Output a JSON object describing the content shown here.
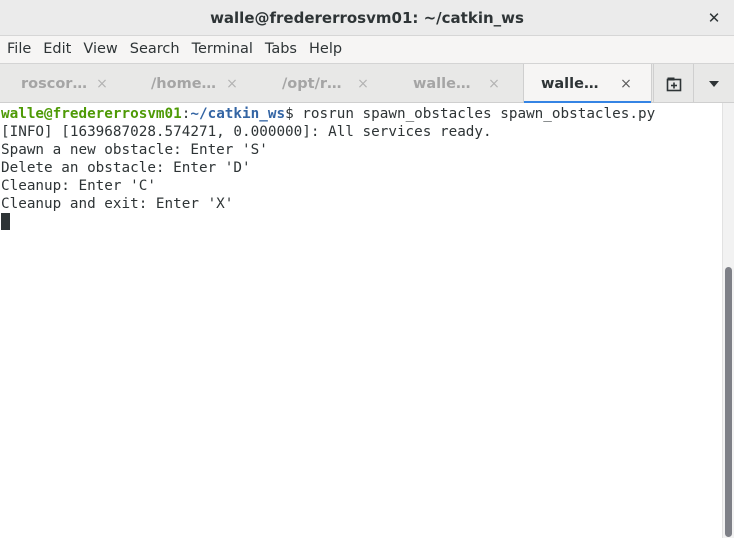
{
  "window": {
    "title": "walle@fredererrosvm01: ~/catkin_ws",
    "close_glyph": "✕"
  },
  "menu": [
    "File",
    "Edit",
    "View",
    "Search",
    "Terminal",
    "Tabs",
    "Help"
  ],
  "tabs": [
    {
      "label": "roscor…",
      "active": false
    },
    {
      "label": "/home…",
      "active": false
    },
    {
      "label": "/opt/r…",
      "active": false
    },
    {
      "label": "walle…",
      "active": false
    },
    {
      "label": "walle…",
      "active": true
    }
  ],
  "tab_close_glyph": "×",
  "icons": {
    "new_tab": "new-tab-icon",
    "tab_menu": "chevron-down-icon"
  },
  "terminal": {
    "prompt_user": "walle@fredererrosvm01",
    "prompt_sep": ":",
    "prompt_path": "~/catkin_ws",
    "prompt_end": "$ ",
    "command": "rosrun spawn_obstacles spawn_obstacles.py",
    "output": [
      "[INFO] [1639687028.574271, 0.000000]: All services ready.",
      "Spawn a new obstacle: Enter 'S'",
      "Delete an obstacle: Enter 'D'",
      "Cleanup: Enter 'C'",
      "Cleanup and exit: Enter 'X'"
    ]
  },
  "colors": {
    "prompt_user": "#4e9a06",
    "prompt_path": "#3465a4",
    "active_tab_underline": "#3584e4",
    "text": "#2e3436"
  }
}
